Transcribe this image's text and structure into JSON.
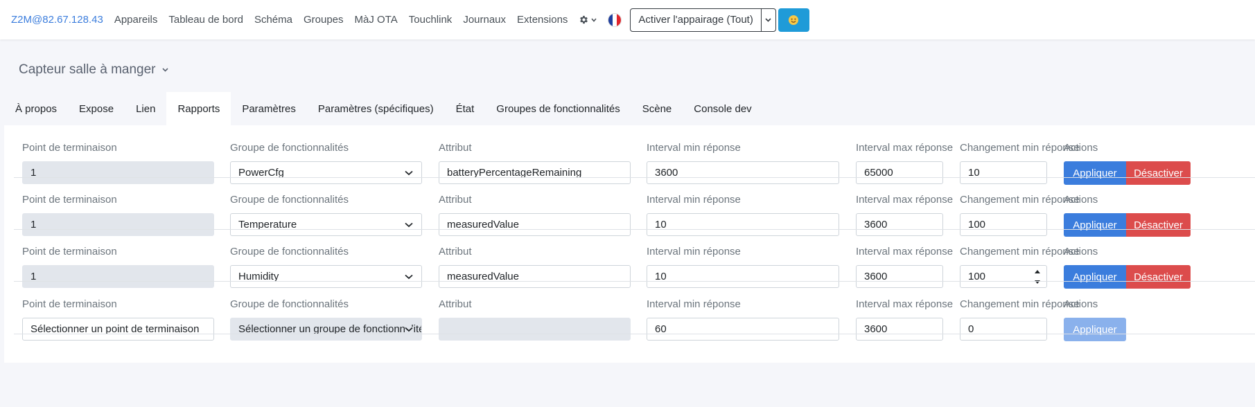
{
  "navbar": {
    "brand": "Z2M@82.67.128.43",
    "links": [
      "Appareils",
      "Tableau de bord",
      "Schéma",
      "Groupes",
      "MàJ OTA",
      "Touchlink",
      "Journaux",
      "Extensions"
    ],
    "settings_icon": "gear-icon",
    "language_icon": "french-flag-icon",
    "permit_join_label": "Activer l'appairage (Tout)",
    "theme_icon": "sun-face-icon"
  },
  "device": {
    "name": "Capteur salle à manger"
  },
  "tabs": [
    "À propos",
    "Expose",
    "Lien",
    "Rapports",
    "Paramètres",
    "Paramètres (spécifiques)",
    "État",
    "Groupes de fonctionnalités",
    "Scène",
    "Console dev"
  ],
  "active_tab": "Rapports",
  "labels": {
    "endpoint": "Point de terminaison",
    "cluster": "Groupe de fonctionnalités",
    "attribute": "Attribut",
    "min_interval": "Interval min réponse",
    "max_interval": "Interval max réponse",
    "min_change": "Changement min réponse",
    "actions": "Actions",
    "apply": "Appliquer",
    "disable": "Désactiver"
  },
  "reportings": [
    {
      "endpoint": "1",
      "cluster": "PowerCfg",
      "attribute": "batteryPercentageRemaining",
      "min_interval": "3600",
      "max_interval": "65000",
      "min_change": "10"
    },
    {
      "endpoint": "1",
      "cluster": "Temperature",
      "attribute": "measuredValue",
      "min_interval": "10",
      "max_interval": "3600",
      "min_change": "100"
    },
    {
      "endpoint": "1",
      "cluster": "Humidity",
      "attribute": "measuredValue",
      "min_interval": "10",
      "max_interval": "3600",
      "min_change": "100"
    },
    {
      "endpoint": "Sélectionner un point de terminaison",
      "cluster": "Sélectionner un groupe de fonctionnalités",
      "attribute": "",
      "min_interval": "60",
      "max_interval": "3600",
      "min_change": "0"
    }
  ],
  "colors": {
    "primary": "#3b7ddd",
    "danger": "#dc4c4c",
    "info": "#1f9bd8"
  }
}
